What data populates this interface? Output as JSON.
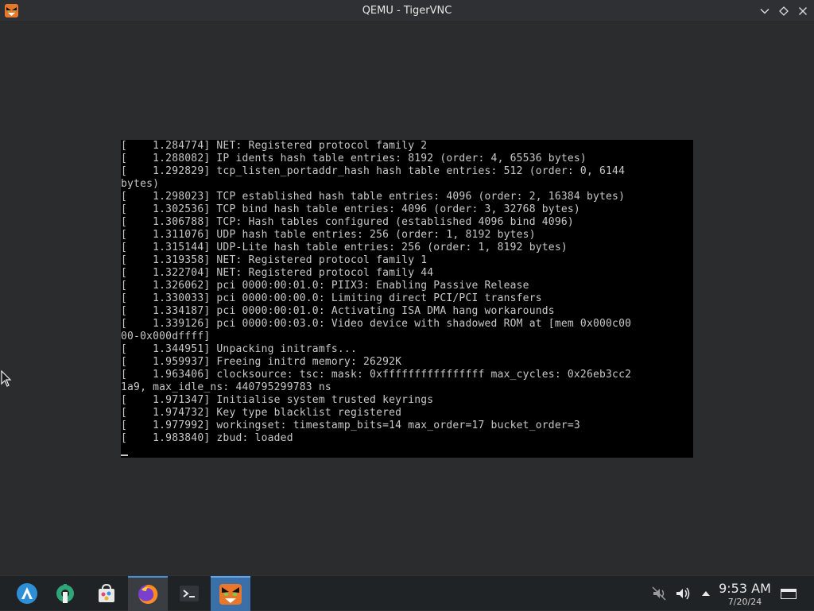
{
  "window": {
    "title": "QEMU - TigerVNC",
    "app_icon": "tigervnc-icon",
    "controls": [
      "minimize-icon",
      "maximize-icon",
      "close-icon"
    ]
  },
  "console": {
    "lines": [
      "[    1.284774] NET: Registered protocol family 2",
      "[    1.288082] IP idents hash table entries: 8192 (order: 4, 65536 bytes)",
      "[    1.292829] tcp_listen_portaddr_hash hash table entries: 512 (order: 0, 6144",
      "bytes)",
      "[    1.298023] TCP established hash table entries: 4096 (order: 2, 16384 bytes)",
      "[    1.302536] TCP bind hash table entries: 4096 (order: 3, 32768 bytes)",
      "[    1.306788] TCP: Hash tables configured (established 4096 bind 4096)",
      "[    1.311076] UDP hash table entries: 256 (order: 1, 8192 bytes)",
      "[    1.315144] UDP-Lite hash table entries: 256 (order: 1, 8192 bytes)",
      "[    1.319358] NET: Registered protocol family 1",
      "[    1.322704] NET: Registered protocol family 44",
      "[    1.326062] pci 0000:00:01.0: PIIX3: Enabling Passive Release",
      "[    1.330033] pci 0000:00:00.0: Limiting direct PCI/PCI transfers",
      "[    1.334187] pci 0000:00:01.0: Activating ISA DMA hang workarounds",
      "[    1.339126] pci 0000:00:03.0: Video device with shadowed ROM at [mem 0x000c00",
      "00-0x000dffff]",
      "[    1.344951] Unpacking initramfs...",
      "[    1.959937] Freeing initrd memory: 26292K",
      "[    1.963406] clocksource: tsc: mask: 0xffffffffffffffff max_cycles: 0x26eb3cc2",
      "1a9, max_idle_ns: 440795299783 ns",
      "[    1.971347] Initialise system trusted keyrings",
      "[    1.974732] Key type blacklist registered",
      "[    1.977992] workingset: timestamp_bits=14 max_order=17 bucket_order=3",
      "[    1.983840] zbud: loaded"
    ],
    "cursor": "_"
  },
  "taskbar": {
    "items": [
      {
        "name": "application-launcher-icon"
      },
      {
        "name": "system-settings-icon"
      },
      {
        "name": "discover-store-icon"
      },
      {
        "name": "firefox-icon",
        "active": true
      },
      {
        "name": "terminal-icon"
      },
      {
        "name": "tigervnc-icon",
        "active": true,
        "highlight": true
      }
    ],
    "tray": [
      "muted-network-icon",
      "volume-icon",
      "expand-tray-icon"
    ],
    "clock": {
      "time": "9:53 AM",
      "date": "7/20/24"
    },
    "show_desktop": "show-desktop-icon"
  }
}
